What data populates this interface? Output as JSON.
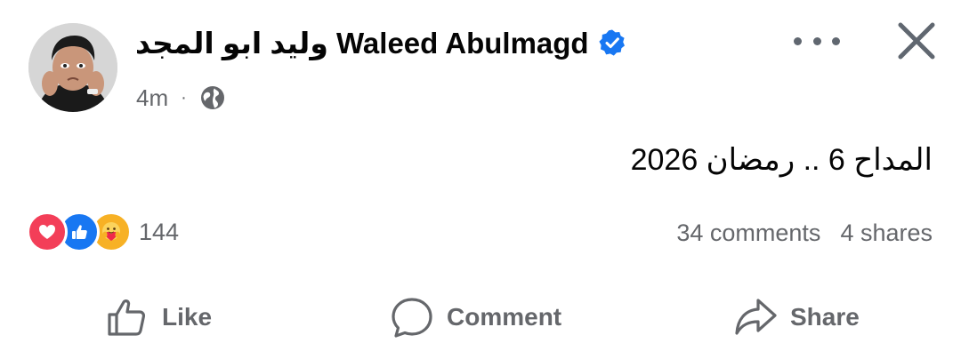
{
  "post": {
    "author_name": "وليد ابو المجد Waleed Abulmagd",
    "verified_icon": "verified-badge-icon",
    "timestamp": "4m",
    "separator": "·",
    "audience_icon": "globe-icon",
    "text": "المداح 6 .. رمضان 2026"
  },
  "reactions": {
    "icons": [
      "love-icon",
      "like-icon",
      "care-icon"
    ],
    "count": "144"
  },
  "stats": {
    "comments": "34 comments",
    "shares": "4 shares"
  },
  "actions": {
    "like_label": "Like",
    "comment_label": "Comment",
    "share_label": "Share"
  },
  "colors": {
    "accent": "#1877f2",
    "love": "#f33e58",
    "care": "#f7b125",
    "secondary_text": "#65676b"
  }
}
